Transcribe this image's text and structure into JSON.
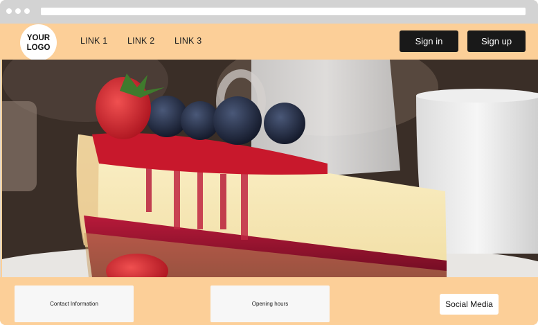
{
  "header": {
    "logo_text": "YOUR LOGO",
    "nav": [
      {
        "label": "LINK 1"
      },
      {
        "label": "LINK 2"
      },
      {
        "label": "LINK 3"
      }
    ],
    "sign_in_label": "Sign in",
    "sign_up_label": "Sign up"
  },
  "hero": {
    "image_subject": "cheesecake-slice-with-berries-photo"
  },
  "footer": {
    "contact_label": "Contact Information",
    "hours_label": "Opening hours",
    "social_label": "Social Media"
  },
  "colors": {
    "page_bg": "#fccf98",
    "button_bg": "#191919",
    "button_text": "#ffffff",
    "chrome_bg": "#d3d3d3"
  }
}
